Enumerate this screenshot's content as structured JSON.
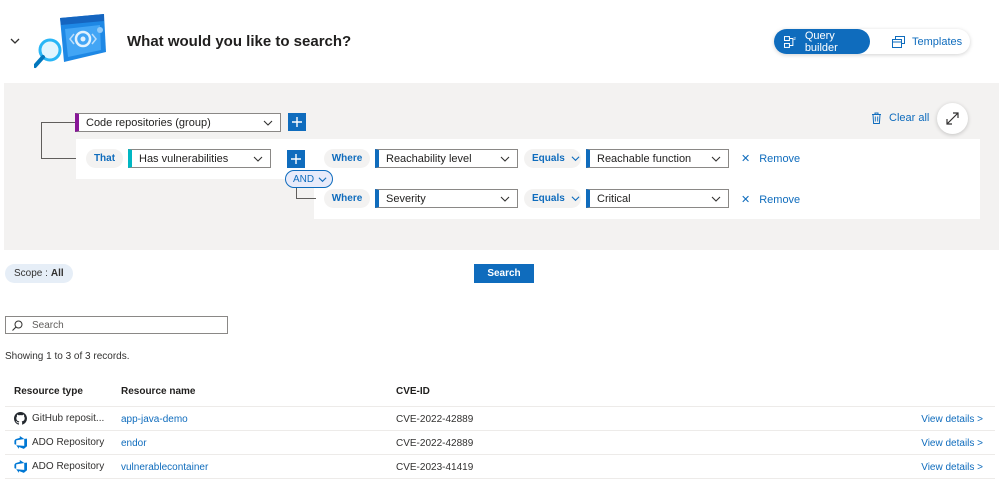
{
  "header": {
    "title": "What would you like to search?",
    "toggle": {
      "query_builder": "Query builder",
      "templates": "Templates",
      "active": "query_builder"
    }
  },
  "builder": {
    "root_dropdown": "Code repositories (group)",
    "that_label": "That",
    "condition_dropdown": "Has vulnerabilities",
    "and_label": "AND",
    "clear_all": "Clear all",
    "filters": [
      {
        "where_label": "Where",
        "field": "Reachability level",
        "operator": "Equals",
        "value": "Reachable function",
        "remove_label": "Remove"
      },
      {
        "where_label": "Where",
        "field": "Severity",
        "operator": "Equals",
        "value": "Critical",
        "remove_label": "Remove"
      }
    ]
  },
  "scope": {
    "label": "Scope :",
    "value": "All"
  },
  "search_button": "Search",
  "search": {
    "placeholder": "Search",
    "value": ""
  },
  "records_text": "Showing 1 to 3 of 3 records.",
  "table": {
    "columns": [
      "Resource type",
      "Resource name",
      "CVE-ID"
    ],
    "rows": [
      {
        "type": "GitHub reposit...",
        "icon": "github-icon",
        "name": "app-java-demo",
        "cve": "CVE-2022-42889",
        "action": "View details >"
      },
      {
        "type": "ADO Repository",
        "icon": "azure-devops-icon",
        "name": "endor",
        "cve": "CVE-2022-42889",
        "action": "View details >"
      },
      {
        "type": "ADO Repository",
        "icon": "azure-devops-icon",
        "name": "vulnerablecontainer",
        "cve": "CVE-2023-41419",
        "action": "View details >"
      }
    ]
  },
  "colors": {
    "accent": "#0f6cbd",
    "group_marker": "#881798",
    "condition_marker": "#00b7c3",
    "panel_bg": "#f3f2f1"
  }
}
